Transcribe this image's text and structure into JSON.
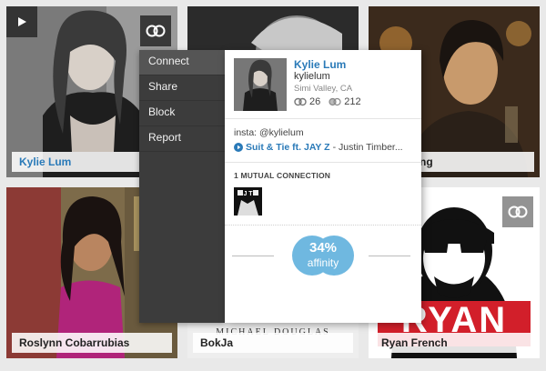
{
  "tiles": [
    {
      "name": "Kylie Lum"
    },
    {
      "name": ""
    },
    {
      "name": "ng"
    },
    {
      "name": "Roslynn Cobarrubias"
    },
    {
      "name": "BokJa"
    },
    {
      "name": "Ryan French"
    }
  ],
  "tile5_photo_text": "MICHAEL DOUGLAS",
  "tile6_photo_text": "RYAN",
  "menu": {
    "items": [
      "Connect",
      "Share",
      "Block",
      "Report"
    ]
  },
  "card": {
    "name": "Kylie Lum",
    "username": "kylielum",
    "location": "Simi Valley, CA",
    "stat_a": "26",
    "stat_b": "212",
    "bio": "insta: @kylielum",
    "song_title": "Suit & Tie ft. JAY Z",
    "song_artist": " - Justin Timber...",
    "mutual_heading": "1 MUTUAL CONNECTION",
    "mutual_thumb_text": "J T",
    "affinity_value": "34%",
    "affinity_label": "affinity"
  },
  "icons": {
    "play": "play-icon",
    "connect": "connect-rings-icon"
  },
  "colors": {
    "accent": "#2a7ab8",
    "affinity": "#6fb8e0",
    "menu_bg": "#3c3c3c"
  }
}
